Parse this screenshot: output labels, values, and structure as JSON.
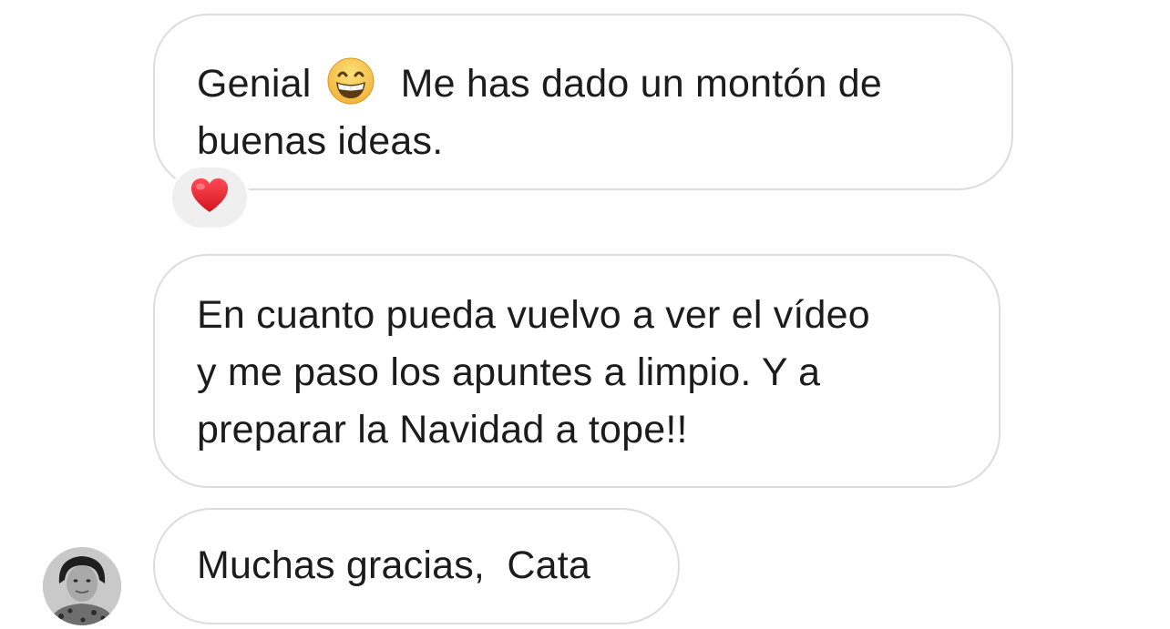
{
  "messages": [
    {
      "part1": "Genial",
      "emoji": "grinning-face-with-smiling-eyes-icon",
      "part2": "Me has dado un montón de",
      "line2": "buenas ideas.",
      "reaction": "red-heart-icon"
    },
    {
      "lines": [
        "En cuanto pueda vuelvo a ver el vídeo",
        "y me paso los apuntes a limpio. Y a",
        "preparar la Navidad a tope!!"
      ]
    },
    {
      "text": "Muchas gracias,  Cata",
      "avatar": "sender-avatar"
    }
  ],
  "colors": {
    "bubble_border": "#dcdcdc",
    "text": "#1c1c1c",
    "reaction_bg": "#efefef",
    "heart": "#e0242d",
    "emoji_face": "#f7c84a"
  }
}
